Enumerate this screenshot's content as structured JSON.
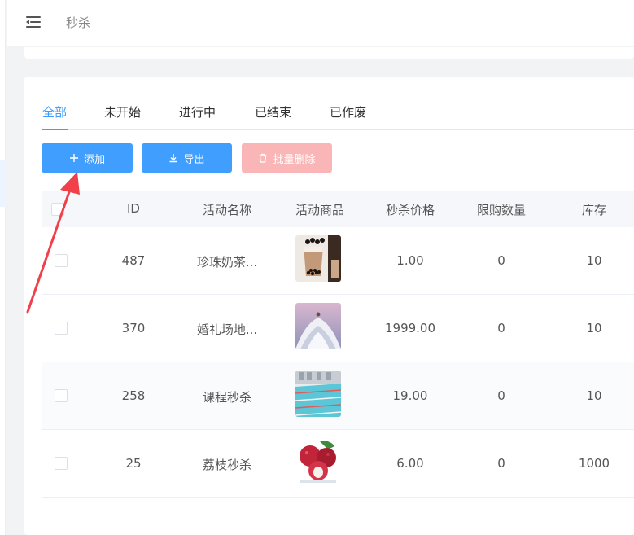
{
  "header": {
    "title": "秒杀"
  },
  "tabs": [
    {
      "label": "全部",
      "active": true
    },
    {
      "label": "未开始",
      "active": false
    },
    {
      "label": "进行中",
      "active": false
    },
    {
      "label": "已结束",
      "active": false
    },
    {
      "label": "已作废",
      "active": false
    }
  ],
  "toolbar": {
    "add_label": "添加",
    "export_label": "导出",
    "delete_label": "批量删除"
  },
  "table": {
    "columns": [
      "ID",
      "活动名称",
      "活动商品",
      "秒杀价格",
      "限购数量",
      "库存"
    ],
    "rows": [
      {
        "id": "487",
        "name": "珍珠奶茶...",
        "goods_icon": "milk-tea-image",
        "price": "1.00",
        "limit": "0",
        "stock": "10"
      },
      {
        "id": "370",
        "name": "婚礼场地...",
        "goods_icon": "wedding-image",
        "price": "1999.00",
        "limit": "0",
        "stock": "10"
      },
      {
        "id": "258",
        "name": "课程秒杀",
        "goods_icon": "swimming-pool-image",
        "price": "19.00",
        "limit": "0",
        "stock": "10"
      },
      {
        "id": "25",
        "name": "荔枝秒杀",
        "goods_icon": "lychee-image",
        "price": "6.00",
        "limit": "0",
        "stock": "1000"
      }
    ]
  },
  "colors": {
    "primary": "#409eff",
    "danger_disabled": "#fab6b6",
    "annotation_arrow": "#f0404a"
  }
}
